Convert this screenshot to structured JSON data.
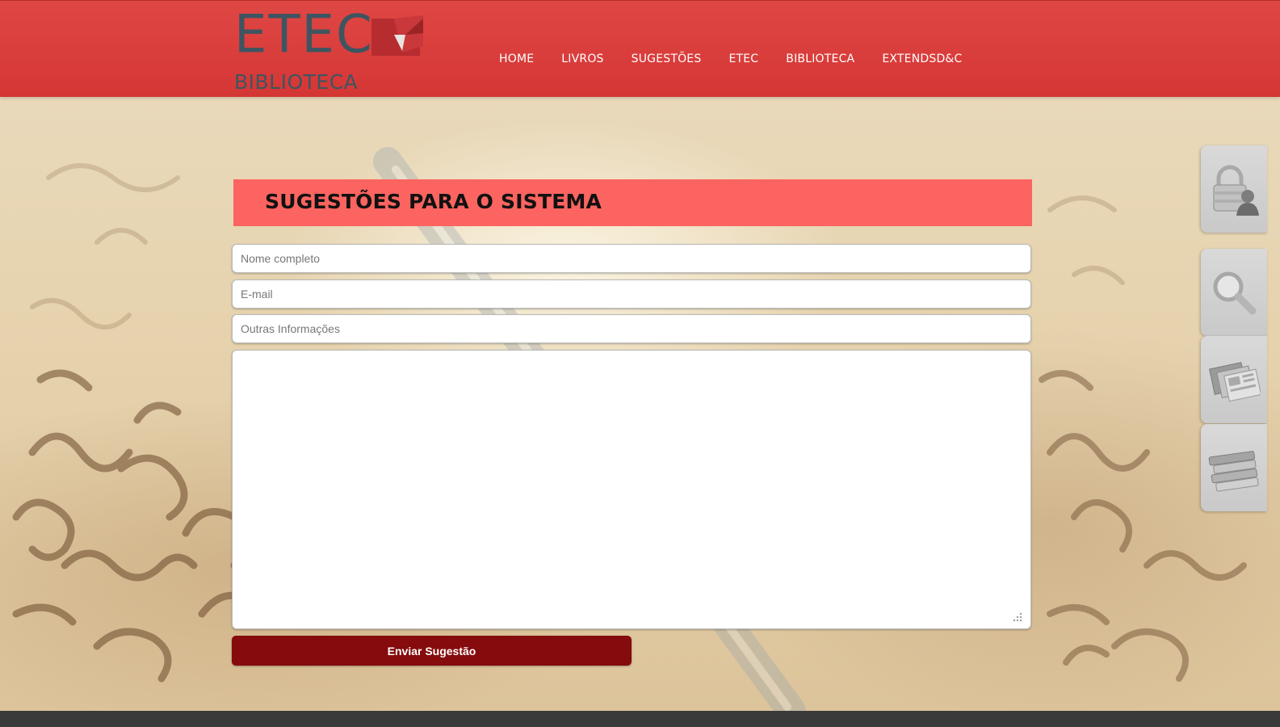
{
  "header": {
    "logo": {
      "title": "ETEC",
      "subtitle": "BIBLIOTECA"
    },
    "nav": [
      {
        "label": "HOME"
      },
      {
        "label": "LIVROS"
      },
      {
        "label": "SUGESTÕES"
      },
      {
        "label": "ETEC"
      },
      {
        "label": "BIBLIOTECA"
      },
      {
        "label": "EXTENDSD&C"
      }
    ]
  },
  "main": {
    "title": "SUGESTÕES PARA O SISTEMA",
    "form": {
      "name_placeholder": "Nome completo",
      "email_placeholder": "E-mail",
      "info_placeholder": "Outras Informações",
      "message_value": "",
      "submit_label": "Enviar Sugestão"
    }
  },
  "sidebar": {
    "buttons": [
      {
        "icon": "lock-user-icon"
      },
      {
        "icon": "search-icon"
      },
      {
        "icon": "newspapers-icon"
      },
      {
        "icon": "books-icon"
      }
    ]
  },
  "colors": {
    "header": "#d93d3b",
    "title_bar": "#fb6460",
    "submit": "#850b0d",
    "logo_text": "#3e5561"
  }
}
